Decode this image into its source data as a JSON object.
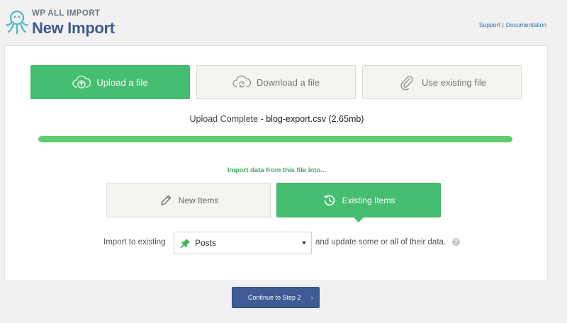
{
  "header": {
    "brand": "WP ALL IMPORT",
    "title": "New Import",
    "links": {
      "support": "Support",
      "separator": "|",
      "documentation": "Documentation"
    }
  },
  "source_buttons": {
    "upload": "Upload a file",
    "download": "Download a file",
    "existing": "Use existing file",
    "active": "upload"
  },
  "upload_status": {
    "label": "Upload Complete",
    "separator": " - ",
    "file": "blog-export.csv (2.65mb)",
    "progress": 1.0
  },
  "import_into": {
    "label": "Import data from this file into...",
    "new_items": "New Items",
    "existing_items": "Existing Items",
    "active": "existing_items"
  },
  "import_row": {
    "prefix": "Import to existing",
    "selected": "Posts",
    "suffix": "and update some or all of their data.",
    "help": "?"
  },
  "continue_button": "Continue to Step 2",
  "colors": {
    "green": "#46be6f",
    "blue": "#3e5b95",
    "progress": "#5fcd6f",
    "link": "#2a6fb0"
  }
}
